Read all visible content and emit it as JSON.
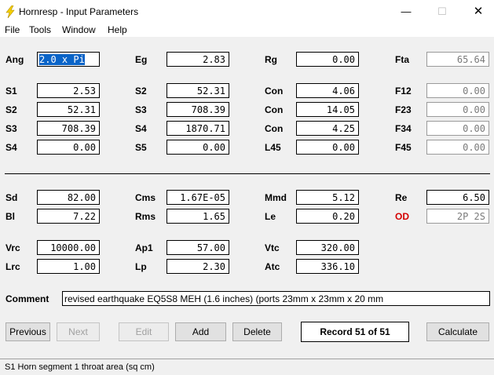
{
  "window": {
    "title": "Hornresp - Input Parameters",
    "minimize": "—",
    "maximize": "☐",
    "close": "✕"
  },
  "menu": [
    "File",
    "Tools",
    "Window",
    "Help"
  ],
  "params": {
    "Ang": "2.0 x Pi",
    "Eg": "2.83",
    "Rg": "0.00",
    "Fta": "65.64",
    "S1": "2.53",
    "S2_row1": "52.31",
    "Con_row1": "4.06",
    "F12": "0.00",
    "S2": "52.31",
    "S3_row2": "708.39",
    "Con_row2": "14.05",
    "F23": "0.00",
    "S3": "708.39",
    "S4_row3": "1870.71",
    "Con_row3": "4.25",
    "F34": "0.00",
    "S4": "0.00",
    "S5": "0.00",
    "L45": "0.00",
    "F45": "0.00",
    "Sd": "82.00",
    "Cms": "1.67E-05",
    "Mmd": "5.12",
    "Re": "6.50",
    "Bl": "7.22",
    "Rms": "1.65",
    "Le": "0.20",
    "OD": "2P 2S",
    "Vrc": "10000.00",
    "Ap1": "57.00",
    "Vtc": "320.00",
    "Lrc": "1.00",
    "Lp": "2.30",
    "Atc": "336.10"
  },
  "labels": {
    "ang": "Ang",
    "eg": "Eg",
    "rg": "Rg",
    "fta": "Fta",
    "s1": "S1",
    "s2": "S2",
    "con": "Con",
    "f12": "F12",
    "s3": "S3",
    "f23": "F23",
    "s4": "S4",
    "f34": "F34",
    "s5": "S5",
    "l45": "L45",
    "f45": "F45",
    "sd": "Sd",
    "cms": "Cms",
    "mmd": "Mmd",
    "re": "Re",
    "bl": "Bl",
    "rms": "Rms",
    "le": "Le",
    "od": "OD",
    "vrc": "Vrc",
    "ap1": "Ap1",
    "vtc": "Vtc",
    "lrc": "Lrc",
    "lp": "Lp",
    "atc": "Atc",
    "comment": "Comment"
  },
  "comment": "revised earthquake EQ5S8 MEH (1.6 inches) (ports 23mm x 23mm x 20 mm",
  "buttons": {
    "previous": "Previous",
    "next": "Next",
    "edit": "Edit",
    "add": "Add",
    "delete": "Delete",
    "calculate": "Calculate"
  },
  "record": "Record 51 of 51",
  "status": "S1   Horn segment 1 throat area  (sq cm)",
  "colors": {
    "od_label": "#d40000",
    "selection": "#0a64c8"
  }
}
